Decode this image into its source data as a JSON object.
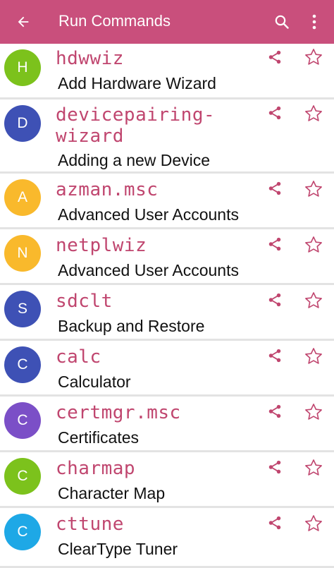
{
  "appbar": {
    "title": "Run Commands",
    "back_icon": "arrow-left-icon",
    "search_icon": "search-icon",
    "menu_icon": "more-vertical-icon",
    "background_color": "#c94f7c"
  },
  "accent_color": "#c0466f",
  "items": [
    {
      "initial": "H",
      "command": "hdwwiz",
      "description": "Add Hardware Wizard",
      "avatar_color": "#7cc21c"
    },
    {
      "initial": "D",
      "command": "devicepairing-wizard",
      "command_line1": "devicepairing-",
      "command_line2": "wizard",
      "description": "Adding a new Device",
      "avatar_color": "#3e51b5"
    },
    {
      "initial": "A",
      "command": "azman.msc",
      "description": "Advanced User Accounts",
      "avatar_color": "#f9b92c"
    },
    {
      "initial": "N",
      "command": "netplwiz",
      "description": "Advanced User Accounts",
      "avatar_color": "#f9b92c"
    },
    {
      "initial": "S",
      "command": "sdclt",
      "description": "Backup and Restore",
      "avatar_color": "#3e51b5"
    },
    {
      "initial": "C",
      "command": "calc",
      "description": "Calculator",
      "avatar_color": "#3e51b5"
    },
    {
      "initial": "C",
      "command": "certmgr.msc",
      "description": "Certificates",
      "avatar_color": "#7b4fc7"
    },
    {
      "initial": "C",
      "command": "charmap",
      "description": "Character Map",
      "avatar_color": "#7cc21c"
    },
    {
      "initial": "C",
      "command": "cttune",
      "description": "ClearType Tuner",
      "avatar_color": "#1ea8e6"
    }
  ]
}
